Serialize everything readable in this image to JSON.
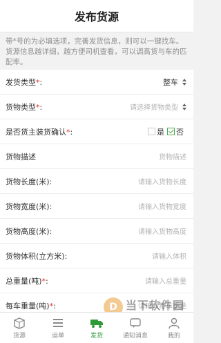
{
  "header": {
    "title": "发布货源"
  },
  "notice": "带*号的为必填选项，完善发货信息，则可以一键找车。货源信息越详细，越方便司机查看，可以调高货与车的匹配率。",
  "form": {
    "rows": [
      {
        "label": "发货类型",
        "required": true,
        "value": "整车"
      },
      {
        "label": "货物类型",
        "required": true,
        "placeholder": "请选择货物类型"
      },
      {
        "label": "是否货主装货确认",
        "required": true,
        "yes": "是",
        "no": "否",
        "selected": "否"
      },
      {
        "label": "货物描述",
        "required": false,
        "placeholder": "货物描述"
      },
      {
        "label": "货物长度(米):",
        "required": false,
        "placeholder": "请输入货物长度"
      },
      {
        "label": "货物宽度(米):",
        "required": false,
        "placeholder": "请输入货物宽度"
      },
      {
        "label": "货物高度(米):",
        "required": false,
        "placeholder": "请输入货物高度"
      },
      {
        "label": "货物体积(立方米):",
        "required": false,
        "placeholder": "请输入体积"
      },
      {
        "label": "总重量(吨)",
        "required": true,
        "placeholder": "请输入总重量"
      },
      {
        "label": "每车重量(吨)",
        "required": true,
        "placeholder": "请输入每车重量"
      }
    ]
  },
  "tabbar": {
    "items": [
      {
        "label": "货源",
        "icon": "box-icon",
        "active": false
      },
      {
        "label": "运单",
        "icon": "list-icon",
        "active": false
      },
      {
        "label": "发货",
        "icon": "truck-icon",
        "active": true
      },
      {
        "label": "通知消息",
        "icon": "message-icon",
        "active": false
      },
      {
        "label": "我的",
        "icon": "user-icon",
        "active": false
      }
    ]
  },
  "watermark": {
    "big": "当下软件园",
    "small": "www.downxia.com",
    "logo": "D"
  },
  "colors": {
    "accent": "#2e9a3a",
    "required": "#e0302c",
    "placeholder": "#b3b3b3"
  }
}
